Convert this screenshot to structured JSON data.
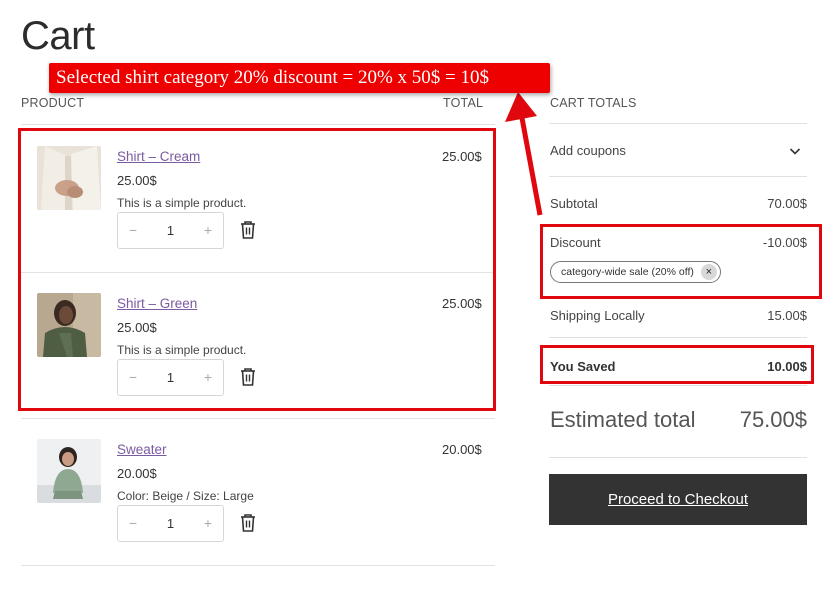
{
  "page": {
    "title": "Cart"
  },
  "table": {
    "col_product": "PRODUCT",
    "col_total": "TOTAL"
  },
  "items": [
    {
      "name": "Shirt – Cream",
      "price": "25.00$",
      "description": "This is a simple product.",
      "quantity": "1",
      "total": "25.00$"
    },
    {
      "name": "Shirt – Green",
      "price": "25.00$",
      "description": "This is a simple product.",
      "quantity": "1",
      "total": "25.00$"
    },
    {
      "name": "Sweater",
      "price": "20.00$",
      "description": "Color: Beige / Size: Large",
      "quantity": "1",
      "total": "20.00$"
    }
  ],
  "qty_controls": {
    "minus": "−",
    "plus": "+"
  },
  "totals": {
    "heading": "CART TOTALS",
    "coupons_label": "Add coupons",
    "subtotal_label": "Subtotal",
    "subtotal_value": "70.00$",
    "discount_label": "Discount",
    "discount_value": "-10.00$",
    "coupon_chip": "category-wide sale (20% off)",
    "coupon_remove": "×",
    "shipping_label": "Shipping Locally",
    "shipping_value": "15.00$",
    "saved_label": "You Saved",
    "saved_value": "10.00$",
    "estimated_label": "Estimated total",
    "estimated_value": "75.00$",
    "checkout_label": "Proceed to Checkout"
  },
  "annotation": {
    "text": "Selected shirt category 20% discount = 20% x 50$ = 10$",
    "color": "#ee0000"
  },
  "colors": {
    "link": "#7a5aa0",
    "highlight_border": "#e1070f",
    "checkout_bg": "#333333"
  }
}
